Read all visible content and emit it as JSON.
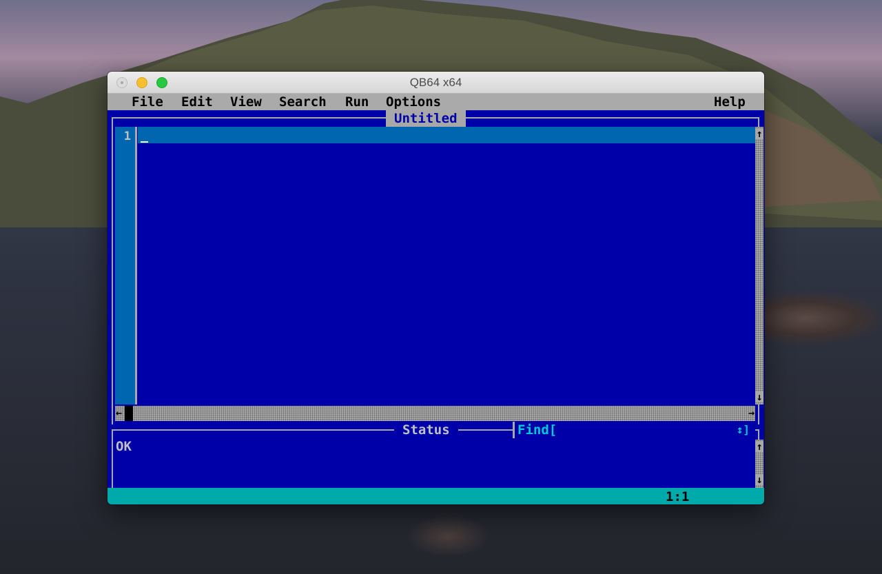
{
  "window": {
    "title": "QB64 x64"
  },
  "menubar": {
    "items": [
      "File",
      "Edit",
      "View",
      "Search",
      "Run",
      "Options"
    ],
    "help": "Help"
  },
  "editor": {
    "tab_title": "Untitled",
    "line_number": "1",
    "cursor_glyph": "_"
  },
  "scroll": {
    "up": "↑",
    "down": "↓",
    "left": "←",
    "right": "→"
  },
  "status": {
    "label": "Status",
    "text": "OK",
    "find_label": "Find[",
    "find_end": "↕]"
  },
  "bottom_bar": {
    "position": "1:1"
  },
  "colors": {
    "editor_background": "#0000a8",
    "gutter": "#0066b0",
    "menubar": "#aaaaaa",
    "status_bar": "#00aaaa"
  }
}
